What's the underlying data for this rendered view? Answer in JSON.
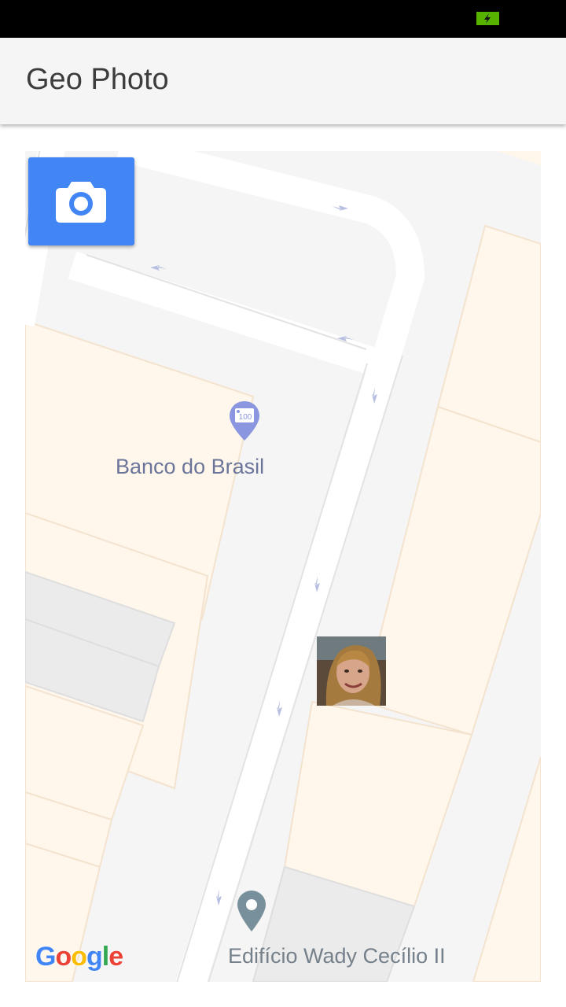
{
  "app": {
    "title": "Geo Photo"
  },
  "map": {
    "camera_button": {
      "icon": "camera-icon",
      "color": "#4285f4"
    },
    "pois": {
      "bank": {
        "label": "Banco do Brasil",
        "icon": "atm-icon",
        "color": "#8b96e0"
      },
      "building": {
        "label": "Edifício Wady Cecílio II",
        "icon": "map-pin-icon",
        "color": "#78909c"
      }
    },
    "photo_marker": {
      "icon": "photo-thumbnail"
    },
    "attribution": {
      "letters": [
        "G",
        "o",
        "o",
        "g",
        "l",
        "e"
      ],
      "colors": [
        "#4285f4",
        "#ea4335",
        "#fbbc05",
        "#4285f4",
        "#34a853",
        "#ea4335"
      ]
    }
  },
  "status_bar": {
    "battery_color": "#55b300"
  }
}
